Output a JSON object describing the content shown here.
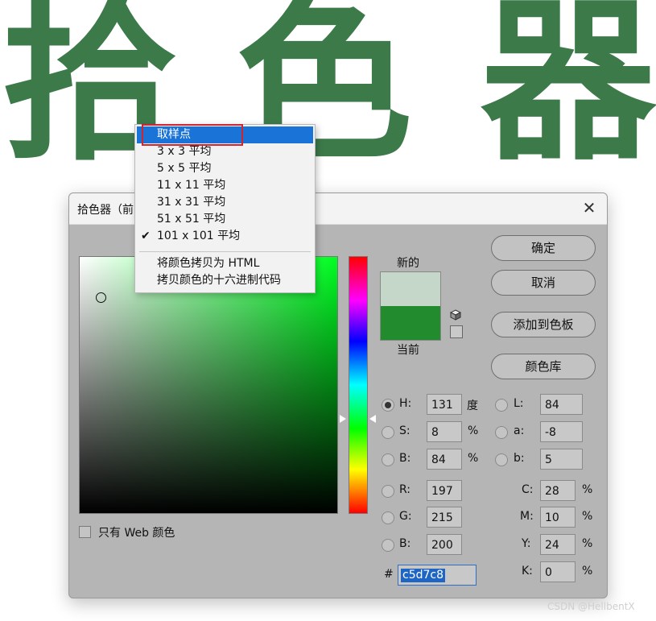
{
  "banner": {
    "chars": [
      "拾",
      "色",
      "器"
    ],
    "color": "#3d7a4a"
  },
  "dialog": {
    "title": "拾色器（前",
    "swatch_labels": {
      "new": "新的",
      "current": "当前"
    },
    "swatch_colors": {
      "new": "#c5d7c8",
      "current": "#228b2e"
    },
    "buttons": {
      "ok": "确定",
      "cancel": "取消",
      "add_swatch": "添加到色板",
      "library": "颜色库"
    },
    "hsb": {
      "h": {
        "label": "H:",
        "value": "131",
        "unit": "度"
      },
      "s": {
        "label": "S:",
        "value": "8",
        "unit": "%"
      },
      "b": {
        "label": "B:",
        "value": "84",
        "unit": "%"
      }
    },
    "lab": {
      "l": {
        "label": "L:",
        "value": "84"
      },
      "a": {
        "label": "a:",
        "value": "-8"
      },
      "b": {
        "label": "b:",
        "value": "5"
      }
    },
    "rgb": {
      "r": {
        "label": "R:",
        "value": "197"
      },
      "g": {
        "label": "G:",
        "value": "215"
      },
      "b": {
        "label": "B:",
        "value": "200"
      }
    },
    "cmyk": {
      "c": {
        "label": "C:",
        "value": "28",
        "unit": "%"
      },
      "m": {
        "label": "M:",
        "value": "10",
        "unit": "%"
      },
      "y": {
        "label": "Y:",
        "value": "24",
        "unit": "%"
      },
      "k": {
        "label": "K:",
        "value": "0",
        "unit": "%"
      }
    },
    "hex": {
      "label": "#",
      "value": "c5d7c8"
    },
    "web_only": "只有 Web 颜色"
  },
  "menu": {
    "items": [
      {
        "label": "取样点",
        "active": true,
        "checked": false
      },
      {
        "label": "3 x 3 平均",
        "active": false,
        "checked": false
      },
      {
        "label": "5 x 5 平均",
        "active": false,
        "checked": false
      },
      {
        "label": "11 x 11 平均",
        "active": false,
        "checked": false
      },
      {
        "label": "31 x 31 平均",
        "active": false,
        "checked": false
      },
      {
        "label": "51 x 51 平均",
        "active": false,
        "checked": false
      },
      {
        "label": "101 x 101 平均",
        "active": false,
        "checked": true
      },
      {
        "label": "将颜色拷贝为 HTML",
        "active": false,
        "checked": false
      },
      {
        "label": "拷贝颜色的十六进制代码",
        "active": false,
        "checked": false
      }
    ],
    "check_glyph": "✔"
  },
  "watermark": "CSDN @HellbentX",
  "close_glyph": "✕"
}
